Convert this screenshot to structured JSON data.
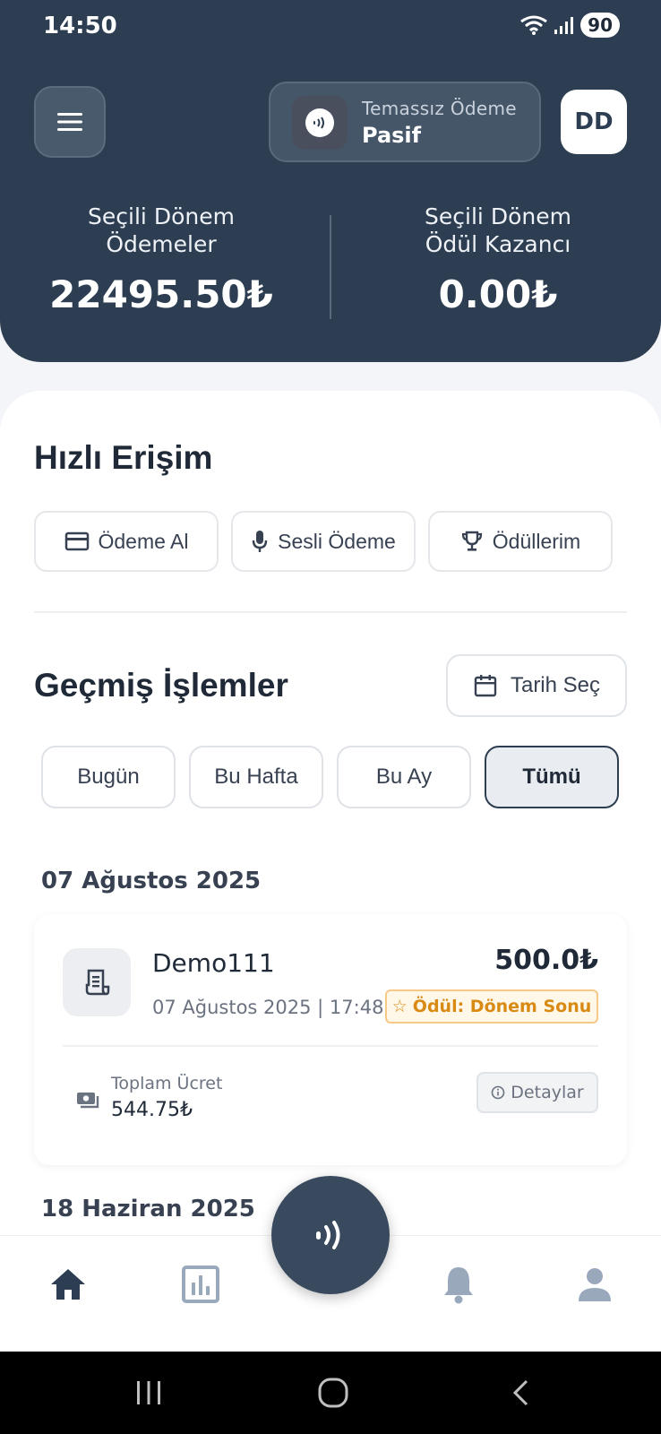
{
  "status_bar": {
    "time": "14:50",
    "battery": "90"
  },
  "header": {
    "nfc": {
      "label": "Temassız Ödeme",
      "status": "Pasif"
    },
    "avatar_initials": "DD",
    "stats": {
      "payments": {
        "title_line1": "Seçili Dönem",
        "title_line2": "Ödemeler",
        "value": "22495.50₺"
      },
      "rewards": {
        "title_line1": "Seçili Dönem",
        "title_line2": "Ödül Kazancı",
        "value": "0.00₺"
      }
    }
  },
  "quick_access": {
    "title": "Hızlı Erişim",
    "items": [
      {
        "label": "Ödeme Al",
        "icon": "credit-card-icon"
      },
      {
        "label": "Sesli Ödeme",
        "icon": "microphone-icon"
      },
      {
        "label": "Ödüllerim",
        "icon": "trophy-icon"
      }
    ]
  },
  "history": {
    "title": "Geçmiş İşlemler",
    "date_picker_label": "Tarih Seç",
    "filters": [
      {
        "label": "Bugün",
        "active": false
      },
      {
        "label": "Bu Hafta",
        "active": false
      },
      {
        "label": "Bu Ay",
        "active": false
      },
      {
        "label": "Tümü",
        "active": true
      }
    ],
    "groups": [
      {
        "date": "07 Ağustos 2025",
        "transactions": [
          {
            "name": "Demo111",
            "amount": "500.0₺",
            "datetime": "07 Ağustos 2025 | 17:48",
            "reward": "Ödül: Dönem Sonu",
            "fee_label": "Toplam Ücret",
            "fee_value": "544.75₺",
            "details_label": "Detaylar"
          }
        ]
      },
      {
        "date": "18 Haziran 2025",
        "transactions": []
      }
    ]
  },
  "bottom_nav": {
    "items": [
      "home-icon",
      "chart-icon",
      "nfc-icon",
      "bell-icon",
      "user-icon"
    ],
    "active": "home-icon"
  },
  "colors": {
    "header_bg": "#2d3e52",
    "accent_orange": "#d98a14",
    "active_nav": "#2d3e52",
    "inactive_nav": "#9aa8bb"
  }
}
